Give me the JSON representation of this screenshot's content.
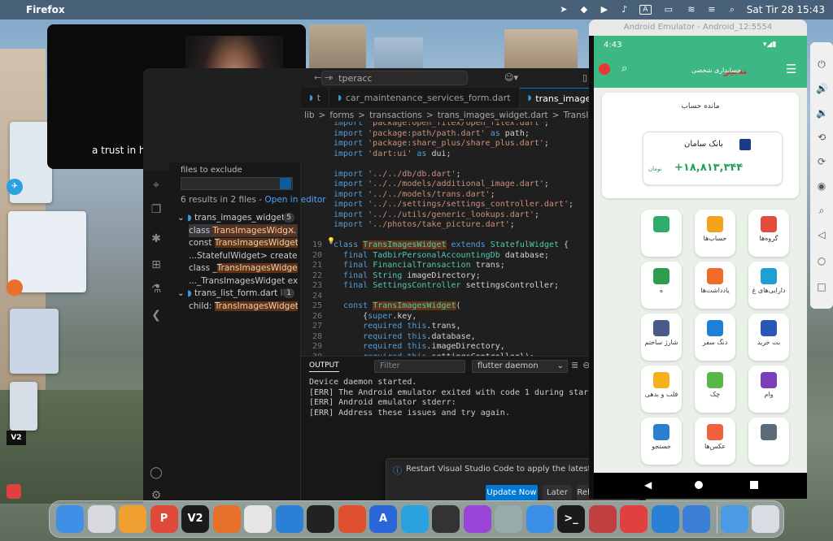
{
  "menubar": {
    "app_name": "Firefox",
    "datetime": "Sat Tir 28  15:43",
    "input_source": "A"
  },
  "video": {
    "caption": "a trust in humanity like Matz does,"
  },
  "vscode": {
    "search_text": "tperacc",
    "tabs": [
      {
        "label": "t",
        "active": false
      },
      {
        "label": "car_maintenance_services_form.dart",
        "active": false
      },
      {
        "label": "trans_images_widget.dart",
        "active": true
      }
    ],
    "breadcrumb": [
      "lib",
      ">",
      "forms",
      ">",
      "transactions",
      ">",
      "trans_images_widget.dart",
      ">",
      "TransImagesWidget"
    ],
    "sidebar": {
      "files_label": "files to exclude",
      "summary": "6 results in 2 files - ",
      "open_editor": "Open in editor",
      "results": [
        {
          "text": "trans_images_widget...",
          "badge": "5",
          "type": "file"
        },
        {
          "pre": "class ",
          "match": "TransImagesWidg...",
          "type": "match",
          "selected": true
        },
        {
          "pre": "const ",
          "match": "TransImagesWidget",
          "post": "(",
          "type": "match"
        },
        {
          "pre": "...StatefulWidget> createStat...",
          "match": "",
          "type": "match"
        },
        {
          "pre": "class _",
          "match": "TransImagesWidget",
          "post": " e...",
          "type": "match"
        },
        {
          "pre": "..._TransImagesWidget exten...",
          "match": "",
          "type": "match"
        },
        {
          "text": "trans_list_form.dart",
          "extra": "li...",
          "badge": "1",
          "type": "file"
        },
        {
          "pre": "child: ",
          "match": "TransImagesWidget",
          "post": "(",
          "type": "match"
        }
      ]
    },
    "code": [
      {
        "n": "",
        "t": "import 'package:open_filex/open_filex.dart';"
      },
      {
        "n": "",
        "t": "import 'package:path/path.dart' as path;"
      },
      {
        "n": "",
        "t": "import 'package:share_plus/share_plus.dart';"
      },
      {
        "n": "",
        "t": "import 'dart:ui' as dui;"
      },
      {
        "n": "",
        "t": ""
      },
      {
        "n": "",
        "t": "import '../../db/db.dart';"
      },
      {
        "n": "",
        "t": "import '../../models/additional_image.dart';"
      },
      {
        "n": "",
        "t": "import '../../models/trans.dart';"
      },
      {
        "n": "",
        "t": "import '../../settings/settings_controller.dart';"
      },
      {
        "n": "",
        "t": "import '../../utils/generic_lookups.dart';"
      },
      {
        "n": "",
        "t": "import '../photos/take_picture.dart';"
      },
      {
        "n": "",
        "t": ""
      },
      {
        "n": "19",
        "t": "class TransImagesWidget extends StatefulWidget {"
      },
      {
        "n": "20",
        "t": "  final TadbirPersonalAccountingDb database;"
      },
      {
        "n": "21",
        "t": "  final FinancialTransaction trans;"
      },
      {
        "n": "22",
        "t": "  final String imageDirectory;"
      },
      {
        "n": "23",
        "t": "  final SettingsController settingsController;"
      },
      {
        "n": "24",
        "t": ""
      },
      {
        "n": "25",
        "t": "  const TransImagesWidget("
      },
      {
        "n": "26",
        "t": "      {super.key,"
      },
      {
        "n": "27",
        "t": "      required this.trans,"
      },
      {
        "n": "28",
        "t": "      required this.database,"
      },
      {
        "n": "29",
        "t": "      required this.imageDirectory,"
      },
      {
        "n": "30",
        "t": "      required this.settingsController});"
      }
    ],
    "panel": {
      "tab": "OUTPUT",
      "filter_placeholder": "Filter",
      "channel": "flutter daemon",
      "lines": [
        "Device daemon started.",
        "[ERR] The Android emulator exited with code 1 during startup",
        "[ERR] Android emulator stderr:",
        "[ERR] Address these issues and try again."
      ]
    },
    "notification": {
      "message": "Restart Visual Studio Code to apply the latest update.",
      "update_now": "Update Now",
      "later": "Later",
      "release_notes": "Release Notes"
    }
  },
  "emulator": {
    "title": "Android Emulator - Android_12:5554",
    "time": "4:43",
    "app_title": "حسابداری شخصی",
    "balance_label": "مانده حساب",
    "bank_name": "بانک سامان",
    "amount": "+۱۸,۸۱۳,۳۴۴",
    "currency": "تومان",
    "tiles": [
      {
        "label": "",
        "color": "#2fae6b"
      },
      {
        "label": "حساب‌ها",
        "color": "#f2a21b"
      },
      {
        "label": "گروه‌ها",
        "color": "#e54b3c"
      },
      {
        "label": "ه",
        "color": "#2e9d4e"
      },
      {
        "label": "یادداشت‌ها",
        "color": "#f06a2a"
      },
      {
        "label": "دارایی‌های غ",
        "color": "#1ea0d5"
      },
      {
        "label": "شارژ ساختم",
        "color": "#4a5a88"
      },
      {
        "label": "دنگ سفر",
        "color": "#1e7fd6"
      },
      {
        "label": "بت خرید",
        "color": "#2a56b8"
      },
      {
        "label": "قلب و بدهی",
        "color": "#f3b21b"
      },
      {
        "label": "چک",
        "color": "#58b847"
      },
      {
        "label": "وام",
        "color": "#7a3fb8"
      },
      {
        "label": "جستجو",
        "color": "#2b7fd0"
      },
      {
        "label": "عکس‌ها",
        "color": "#f0603a"
      },
      {
        "label": "",
        "color": "#5b6b7a"
      }
    ]
  },
  "dock": [
    {
      "name": "finder",
      "color": "#3f8fe6",
      "glyph": ""
    },
    {
      "name": "launchpad",
      "color": "#d9d9e0",
      "glyph": ""
    },
    {
      "name": "app",
      "color": "#f0a030",
      "glyph": ""
    },
    {
      "name": "p-app",
      "color": "#e04a3a",
      "glyph": "P"
    },
    {
      "name": "v2",
      "color": "#1b1b1b",
      "glyph": "V2"
    },
    {
      "name": "firefox",
      "color": "#e8702a",
      "glyph": ""
    },
    {
      "name": "chrome",
      "color": "#e6e6e6",
      "glyph": ""
    },
    {
      "name": "vscode",
      "color": "#2a7fd6",
      "glyph": ""
    },
    {
      "name": "cube",
      "color": "#222",
      "glyph": ""
    },
    {
      "name": "remote",
      "color": "#e05030",
      "glyph": ""
    },
    {
      "name": "xcode-instruments",
      "color": "#2a66d8",
      "glyph": "A"
    },
    {
      "name": "telegram",
      "color": "#2aa2e0",
      "glyph": ""
    },
    {
      "name": "obs",
      "color": "#333",
      "glyph": ""
    },
    {
      "name": "podcasts",
      "color": "#9a45d8",
      "glyph": ""
    },
    {
      "name": "database",
      "color": "#9aa",
      "glyph": ""
    },
    {
      "name": "xcode",
      "color": "#3b8fe6",
      "glyph": ""
    },
    {
      "name": "terminal",
      "color": "#1a1a1a",
      "glyph": ">_"
    },
    {
      "name": "books",
      "color": "#c04040",
      "glyph": ""
    },
    {
      "name": "anydesk",
      "color": "#e04040",
      "glyph": ""
    },
    {
      "name": "windows",
      "color": "#2a7fd6",
      "glyph": ""
    },
    {
      "name": "android-studio",
      "color": "#3b7fd8",
      "glyph": ""
    },
    {
      "name": "folder",
      "color": "#4a9ae6",
      "glyph": ""
    },
    {
      "name": "trash",
      "color": "#d8dde3",
      "glyph": ""
    }
  ]
}
